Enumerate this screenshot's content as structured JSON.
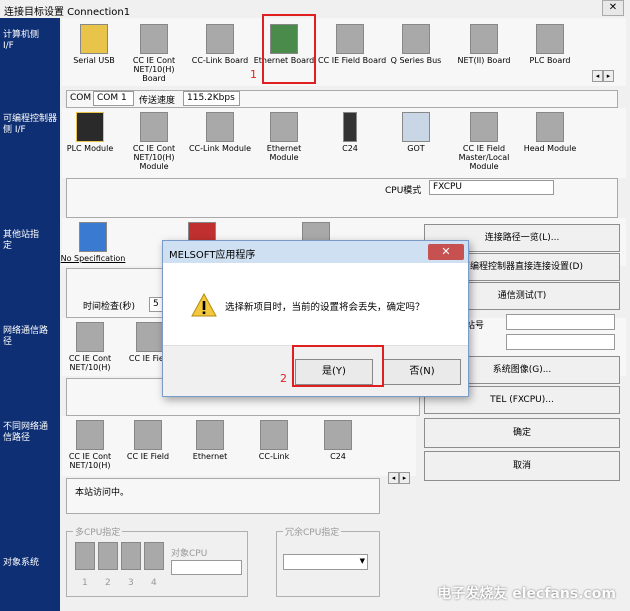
{
  "window": {
    "title": "连接目标设置 Connection1",
    "close": "✕"
  },
  "left_sections": {
    "pc_if": "计算机侧 I/F",
    "plc_if": "可编程控制器侧 I/F",
    "other_station": "其他站指定",
    "network_route": "网络通信路径",
    "diff_network": "不同网络通信路径",
    "target_system": "对象系统"
  },
  "pc_if_items": [
    {
      "label": "Serial USB"
    },
    {
      "label": "CC IE Cont NET/10(H) Board"
    },
    {
      "label": "CC-Link Board"
    },
    {
      "label": "Ethernet Board"
    },
    {
      "label": "CC IE Field Board"
    },
    {
      "label": "Q Series Bus"
    },
    {
      "label": "NET(II) Board"
    },
    {
      "label": "PLC Board"
    }
  ],
  "com_bar": {
    "com_label": "COM",
    "com_value": "COM 1",
    "speed_label": "传送速度",
    "speed_value": "115.2Kbps"
  },
  "plc_if_items": [
    {
      "label": "PLC Module"
    },
    {
      "label": "CC IE Cont NET/10(H) Module"
    },
    {
      "label": "CC-Link Module"
    },
    {
      "label": "Ethernet Module"
    },
    {
      "label": "C24"
    },
    {
      "label": "GOT"
    },
    {
      "label": "CC IE Field Master/Local Module"
    },
    {
      "label": "Head Module"
    }
  ],
  "cpu_mode": {
    "label": "CPU模式",
    "value": "FXCPU"
  },
  "other_station": {
    "no_spec": "No Specification",
    "time_check_label": "时间检查(秒)",
    "time_check_value": "5",
    "station_no_label": "站号"
  },
  "network_items": [
    {
      "label": "CC IE Cont NET/10(H)"
    },
    {
      "label": "CC IE Field"
    }
  ],
  "diff_network_items": [
    {
      "label": "CC IE Cont NET/10(H)"
    },
    {
      "label": "CC IE Field"
    },
    {
      "label": "Ethernet"
    },
    {
      "label": "CC-Link"
    },
    {
      "label": "C24"
    }
  ],
  "status_text": "本站访问中。",
  "multi_cpu": {
    "title": "多CPU指定",
    "target_cpu": "对象CPU",
    "slots": [
      "1",
      "2",
      "3",
      "4"
    ]
  },
  "redundant_cpu": {
    "title": "冗余CPU指定"
  },
  "right_buttons": {
    "route_list": "连接路径一览(L)...",
    "direct_connect": "可编程控制器直接连接设置(D)",
    "comm_test": "通信测试(T)",
    "system_image": "系统图像(G)...",
    "tel": "TEL (FXCPU)...",
    "ok": "确定",
    "cancel": "取消"
  },
  "dialog": {
    "title": "MELSOFT应用程序",
    "message": "选择新项目时，当前的设置将会丢失，确定吗？",
    "yes": "是(Y)",
    "no": "否(N)",
    "close": "✕"
  },
  "annotations": {
    "one": "1",
    "two": "2"
  },
  "watermark": "电子发烧友 elecfans.com",
  "colors": {
    "left_panel": "#0e2f73",
    "highlight": "#e02020",
    "dialog_title": "#cfe0f3"
  }
}
